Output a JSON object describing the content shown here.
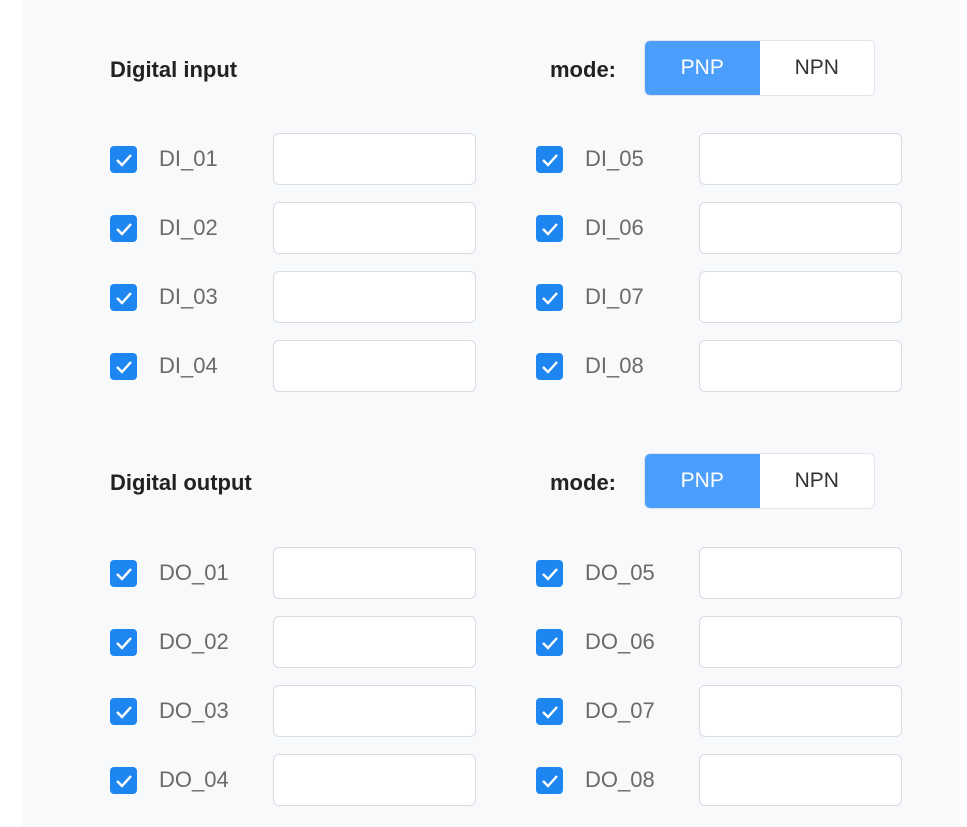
{
  "digital_input": {
    "title": "Digital input",
    "mode_label": "mode:",
    "modes": [
      "PNP",
      "NPN"
    ],
    "selected_mode": "PNP",
    "left_items": [
      {
        "label": "DI_01",
        "checked": true,
        "value": ""
      },
      {
        "label": "DI_02",
        "checked": true,
        "value": ""
      },
      {
        "label": "DI_03",
        "checked": true,
        "value": ""
      },
      {
        "label": "DI_04",
        "checked": true,
        "value": ""
      }
    ],
    "right_items": [
      {
        "label": "DI_05",
        "checked": true,
        "value": ""
      },
      {
        "label": "DI_06",
        "checked": true,
        "value": ""
      },
      {
        "label": "DI_07",
        "checked": true,
        "value": ""
      },
      {
        "label": "DI_08",
        "checked": true,
        "value": ""
      }
    ]
  },
  "digital_output": {
    "title": "Digital output",
    "mode_label": "mode:",
    "modes": [
      "PNP",
      "NPN"
    ],
    "selected_mode": "PNP",
    "left_items": [
      {
        "label": "DO_01",
        "checked": true,
        "value": ""
      },
      {
        "label": "DO_02",
        "checked": true,
        "value": ""
      },
      {
        "label": "DO_03",
        "checked": true,
        "value": ""
      },
      {
        "label": "DO_04",
        "checked": true,
        "value": ""
      }
    ],
    "right_items": [
      {
        "label": "DO_05",
        "checked": true,
        "value": ""
      },
      {
        "label": "DO_06",
        "checked": true,
        "value": ""
      },
      {
        "label": "DO_07",
        "checked": true,
        "value": ""
      },
      {
        "label": "DO_08",
        "checked": true,
        "value": ""
      }
    ]
  },
  "colors": {
    "accent": "#4b9efb",
    "checkbox": "#1e86f0"
  },
  "icons": {
    "checkbox": "checkmark-icon"
  }
}
